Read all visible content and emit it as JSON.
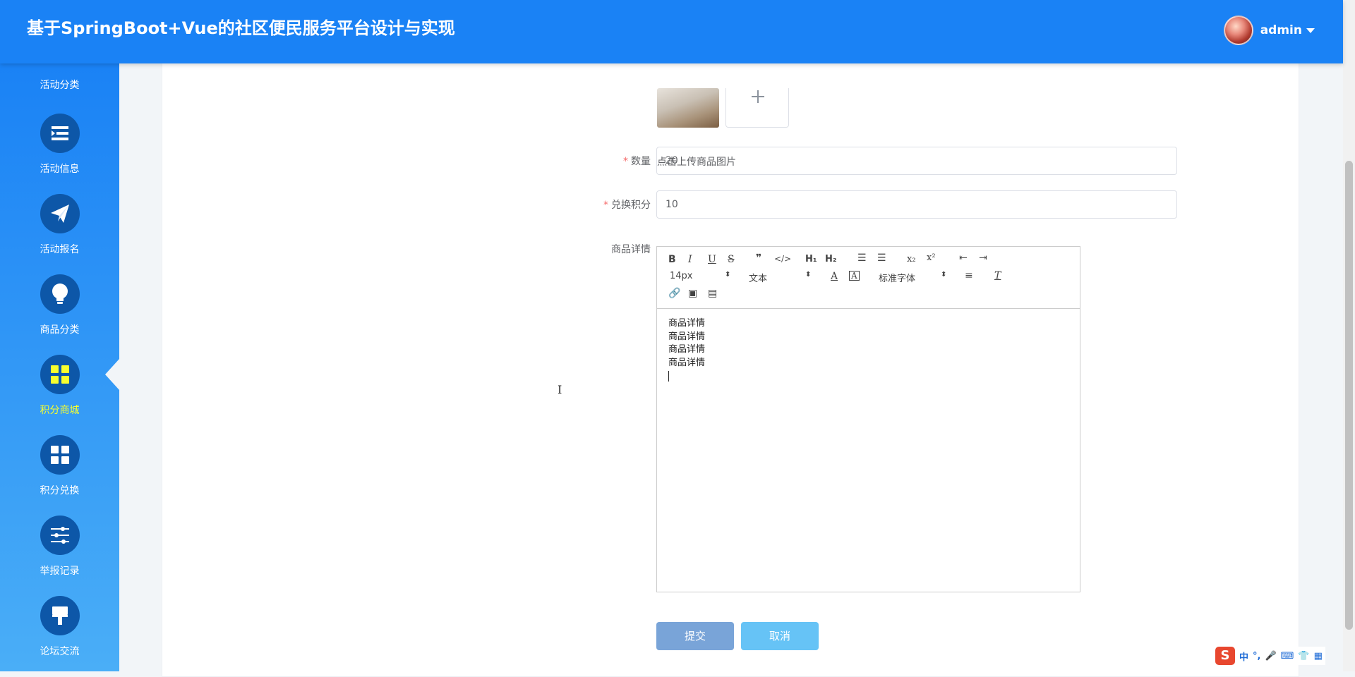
{
  "header": {
    "title": "基于SpringBoot+Vue的社区便民服务平台设计与实现",
    "username": "admin"
  },
  "sidebar": {
    "items": [
      {
        "label": "活动分类",
        "icon": "category-icon"
      },
      {
        "label": "活动信息",
        "icon": "list-icon"
      },
      {
        "label": "活动报名",
        "icon": "paper-plane-icon"
      },
      {
        "label": "商品分类",
        "icon": "lightbulb-icon"
      },
      {
        "label": "积分商城",
        "icon": "grid-icon"
      },
      {
        "label": "积分兑换",
        "icon": "grid-icon"
      },
      {
        "label": "举报记录",
        "icon": "sliders-icon"
      },
      {
        "label": "论坛交流",
        "icon": "brush-icon"
      }
    ],
    "active_index": 4
  },
  "form": {
    "upload_tip": "点击上传商品图片",
    "quantity": {
      "label": "数量",
      "value": "20"
    },
    "points": {
      "label": "兑换积分",
      "value": "10"
    },
    "detail": {
      "label": "商品详情",
      "font_size": "14px",
      "heading": "文本",
      "font": "标准字体",
      "lines": [
        "商品详情",
        "商品详情",
        "商品详情",
        "商品详情"
      ]
    },
    "submit_label": "提交",
    "cancel_label": "取消"
  },
  "ime": {
    "mode": "中",
    "punct": "°,"
  }
}
